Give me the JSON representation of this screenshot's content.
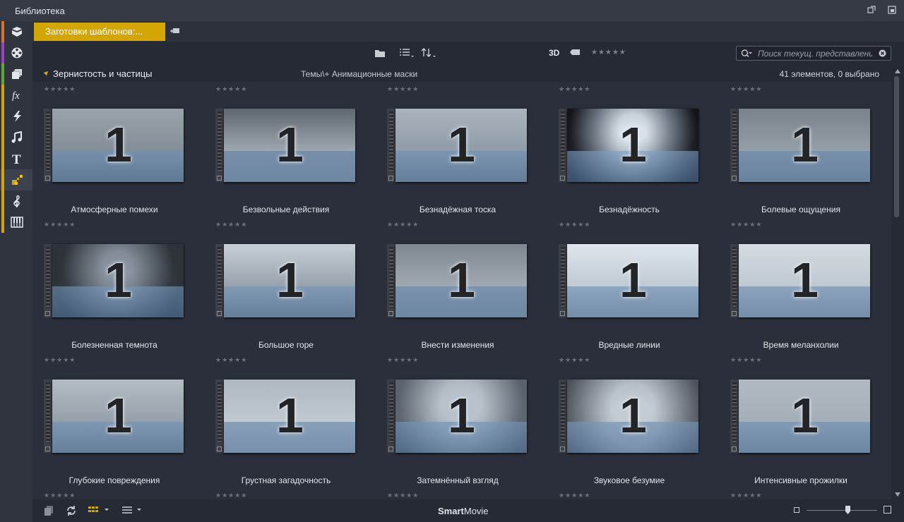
{
  "window": {
    "title": "Библиотека"
  },
  "colors": {
    "accent": "#d4a506",
    "background": "#2b2f3b",
    "panel": "#262a34"
  },
  "sidebar": {
    "items": [
      {
        "icon": "package-icon",
        "color": "#d9722a"
      },
      {
        "icon": "film-reel-icon",
        "color": "#9b3fc7"
      },
      {
        "icon": "clips-stack-icon",
        "color": "#5fa832"
      },
      {
        "icon": "fx-icon",
        "color": "#d4a506"
      },
      {
        "icon": "transition-bolt-icon",
        "color": "#d4a506"
      },
      {
        "icon": "music-note-icon",
        "color": "#d4a506"
      },
      {
        "icon": "title-t-icon",
        "color": "#d4a506"
      },
      {
        "icon": "template-blocks-icon",
        "color": "#d4a506",
        "active": true
      },
      {
        "icon": "treble-clef-icon",
        "color": "#d4a506"
      },
      {
        "icon": "piano-keys-icon",
        "color": "#d4a506"
      }
    ]
  },
  "tabs": {
    "active_label": "Заготовки шаблонов:...",
    "add_icon": "add-tab-icon"
  },
  "toolbar": {
    "folder_icon": "folder-icon",
    "list_icon": "list-view-icon",
    "sort_icon": "sort-icon",
    "label_3d": "3D",
    "tag_icon": "tag-icon",
    "rating_filter": "★★★★★"
  },
  "search": {
    "placeholder": "Поиск текущ. представления",
    "value": ""
  },
  "header": {
    "category": "Зернистость и частицы",
    "path": "Темы\\+ Анимационные маски",
    "count": "41 элементов, 0 выбрано"
  },
  "items": [
    {
      "label": "Атмосферные помехи",
      "rating": "★★★★★"
    },
    {
      "label": "Безвольные действия",
      "rating": "★★★★★"
    },
    {
      "label": "Безнадёжная тоска",
      "rating": "★★★★★"
    },
    {
      "label": "Безнадёжность",
      "rating": "★★★★★"
    },
    {
      "label": "Болевые ощущения",
      "rating": "★★★★★"
    },
    {
      "label": "Болезненная темнота",
      "rating": "★★★★★"
    },
    {
      "label": "Большое горе",
      "rating": "★★★★★"
    },
    {
      "label": "Внести изменения",
      "rating": "★★★★★"
    },
    {
      "label": "Вредные линии",
      "rating": "★★★★★"
    },
    {
      "label": "Время меланхолии",
      "rating": "★★★★★"
    },
    {
      "label": "Глубокие повреждения",
      "rating": "★★★★★"
    },
    {
      "label": "Грустная загадочность",
      "rating": "★★★★★"
    },
    {
      "label": "Затемнённый взгляд",
      "rating": "★★★★★"
    },
    {
      "label": "Звуковое безумие",
      "rating": "★★★★★"
    },
    {
      "label": "Интенсивные прожилки",
      "rating": "★★★★★"
    }
  ],
  "thumbnail_number": "1",
  "top_row_ratings": "★★★★★",
  "bottombar": {
    "smartmovie_bold": "Smart",
    "smartmovie_rest": "Movie",
    "zoom_level": 0.58
  }
}
